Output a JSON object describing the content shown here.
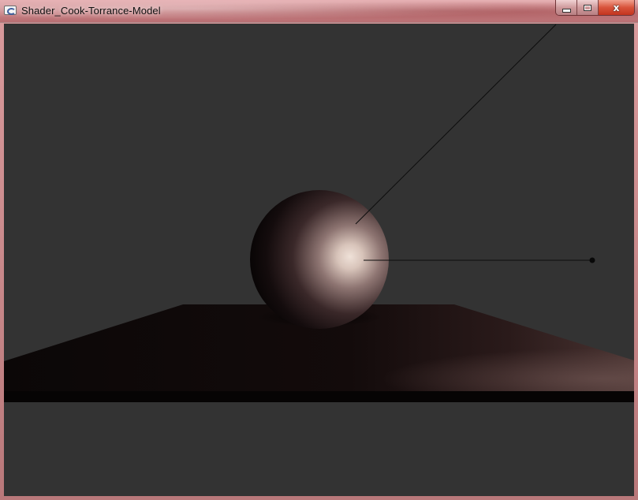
{
  "window": {
    "title": "Shader_Cook-Torrance-Model",
    "controls": {
      "minimize_icon": "minimize-icon",
      "maximize_icon": "maximize-icon",
      "close_icon": "close-icon",
      "close_glyph": "x"
    }
  },
  "scene": {
    "background_color": "#333333",
    "sphere_highlight_color": "#e8d6cc",
    "sphere_shadow_color": "#0a0606",
    "floor_color": "#140b0b"
  }
}
